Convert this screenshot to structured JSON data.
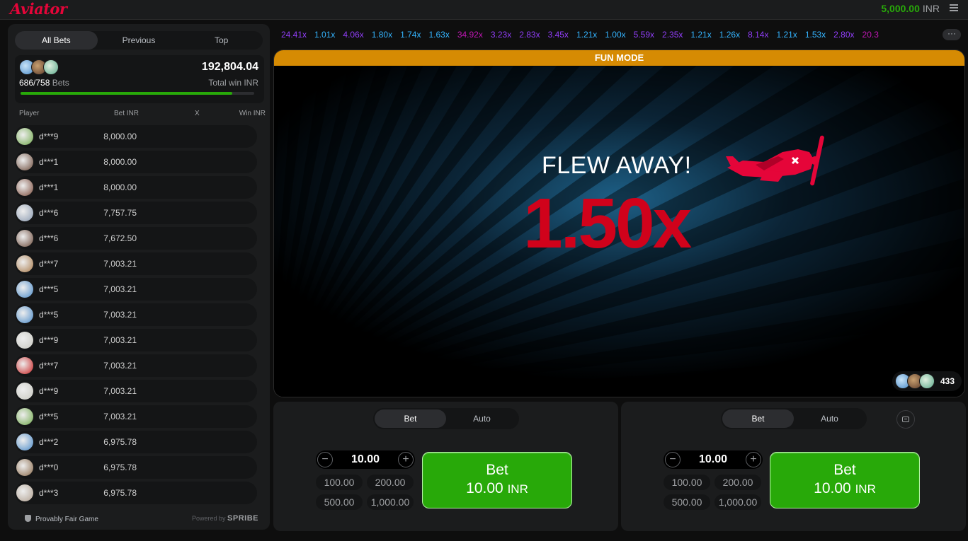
{
  "app": {
    "logo_text": "Aviator"
  },
  "header": {
    "balance": "5,000.00",
    "currency": "INR",
    "menu_icon": "hamburger-menu-icon"
  },
  "bets_panel": {
    "tabs": [
      "All Bets",
      "Previous",
      "Top"
    ],
    "active_tab": "All Bets",
    "bets_count": "686/758",
    "bets_label": "Bets",
    "total_win": "192,804.04",
    "total_win_label": "Total win INR",
    "progress_fraction": 0.905,
    "columns": {
      "player": "Player",
      "bet": "Bet INR",
      "x": "X",
      "win": "Win INR"
    },
    "rows": [
      {
        "name": "d***9",
        "bet": "8,000.00",
        "avatar_color": "#6fa84a"
      },
      {
        "name": "d***1",
        "bet": "8,000.00",
        "avatar_color": "#6b4a3a"
      },
      {
        "name": "d***1",
        "bet": "8,000.00",
        "avatar_color": "#7a4a3a"
      },
      {
        "name": "d***6",
        "bet": "7,757.75",
        "avatar_color": "#8a9ab0"
      },
      {
        "name": "d***6",
        "bet": "7,672.50",
        "avatar_color": "#6b4a3a"
      },
      {
        "name": "d***7",
        "bet": "7,003.21",
        "avatar_color": "#a87a4a"
      },
      {
        "name": "d***5",
        "bet": "7,003.21",
        "avatar_color": "#4a8ac8"
      },
      {
        "name": "d***5",
        "bet": "7,003.21",
        "avatar_color": "#4a8ac8"
      },
      {
        "name": "d***9",
        "bet": "7,003.21",
        "avatar_color": "#c8c8c0"
      },
      {
        "name": "d***7",
        "bet": "7,003.21",
        "avatar_color": "#c82020"
      },
      {
        "name": "d***9",
        "bet": "7,003.21",
        "avatar_color": "#c8c8c0"
      },
      {
        "name": "d***5",
        "bet": "7,003.21",
        "avatar_color": "#6fa84a"
      },
      {
        "name": "d***2",
        "bet": "6,975.78",
        "avatar_color": "#4a8ac8"
      },
      {
        "name": "d***0",
        "bet": "6,975.78",
        "avatar_color": "#8a6a4a"
      },
      {
        "name": "d***3",
        "bet": "6,975.78",
        "avatar_color": "#b0a090"
      }
    ],
    "footer_left": "Provably Fair Game",
    "footer_powered": "Powered by",
    "footer_brand": "SPRIBE"
  },
  "history": [
    {
      "v": "24.41x",
      "c": "#913ef8"
    },
    {
      "v": "1.01x",
      "c": "#34b4ff"
    },
    {
      "v": "4.06x",
      "c": "#913ef8"
    },
    {
      "v": "1.80x",
      "c": "#34b4ff"
    },
    {
      "v": "1.74x",
      "c": "#34b4ff"
    },
    {
      "v": "1.63x",
      "c": "#34b4ff"
    },
    {
      "v": "34.92x",
      "c": "#c017b4"
    },
    {
      "v": "3.23x",
      "c": "#913ef8"
    },
    {
      "v": "2.83x",
      "c": "#913ef8"
    },
    {
      "v": "3.45x",
      "c": "#913ef8"
    },
    {
      "v": "1.21x",
      "c": "#34b4ff"
    },
    {
      "v": "1.00x",
      "c": "#34b4ff"
    },
    {
      "v": "5.59x",
      "c": "#913ef8"
    },
    {
      "v": "2.35x",
      "c": "#913ef8"
    },
    {
      "v": "1.21x",
      "c": "#34b4ff"
    },
    {
      "v": "1.26x",
      "c": "#34b4ff"
    },
    {
      "v": "8.14x",
      "c": "#913ef8"
    },
    {
      "v": "1.21x",
      "c": "#34b4ff"
    },
    {
      "v": "1.53x",
      "c": "#34b4ff"
    },
    {
      "v": "2.80x",
      "c": "#913ef8"
    },
    {
      "v": "20.3",
      "c": "#c017b4"
    }
  ],
  "history_more": "···",
  "game": {
    "mode_label": "FUN MODE",
    "status": "FLEW AWAY!",
    "multiplier": "1.50x",
    "players_online": "433",
    "plane_icon": "red-propeller-plane-icon"
  },
  "bet_panels": [
    {
      "tabs": [
        "Bet",
        "Auto"
      ],
      "active_tab": "Bet",
      "stake": "10.00",
      "quick_amounts": [
        "100.00",
        "200.00",
        "500.00",
        "1,000.00"
      ],
      "button_label": "Bet",
      "button_amount": "10.00",
      "button_currency": "INR"
    },
    {
      "tabs": [
        "Bet",
        "Auto"
      ],
      "active_tab": "Bet",
      "stake": "10.00",
      "quick_amounts": [
        "100.00",
        "200.00",
        "500.00",
        "1,000.00"
      ],
      "button_label": "Bet",
      "button_amount": "10.00",
      "button_currency": "INR"
    }
  ],
  "colors": {
    "accent": "#e50539",
    "green": "#28a909",
    "fun_mode": "#d68b03",
    "multiplier": "#d0021b"
  }
}
